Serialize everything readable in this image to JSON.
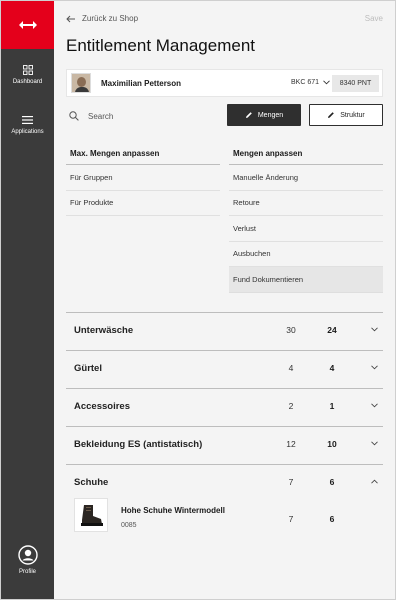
{
  "sidebar": {
    "items": [
      {
        "label": "Dashboard",
        "icon": "grid-icon"
      },
      {
        "label": "Applications",
        "icon": "menu-icon"
      }
    ],
    "profile_label": "Profile",
    "brand_color": "#e4001b"
  },
  "header": {
    "back_label": "Zurück zu Shop",
    "save_label": "Save",
    "title": "Entitlement Management"
  },
  "user": {
    "name": "Maximilian Petterson",
    "account": "BKC 671",
    "points": "8340 PNT"
  },
  "toolbar": {
    "search_placeholder": "Search",
    "mengen_label": "Mengen",
    "struktur_label": "Struktur"
  },
  "left_column": {
    "header": "Max. Mengen anpassen",
    "items": [
      "Für Gruppen",
      "Für Produkte"
    ]
  },
  "right_column": {
    "header": "Mengen anpassen",
    "items": [
      "Manuelle Änderung",
      "Retoure",
      "Verlust",
      "Ausbuchen",
      "Fund Dokumentieren"
    ],
    "active_index": 4
  },
  "categories": [
    {
      "name": "Unterwäsche",
      "v1": "30",
      "v2": "24"
    },
    {
      "name": "Gürtel",
      "v1": "4",
      "v2": "4"
    },
    {
      "name": "Accessoires",
      "v1": "2",
      "v2": "1"
    },
    {
      "name": "Bekleidung ES (antistatisch)",
      "v1": "12",
      "v2": "10"
    }
  ],
  "expanded_category": {
    "name": "Schuhe",
    "v1": "7",
    "v2": "6",
    "product": {
      "name": "Hohe Schuhe Wintermodell",
      "code": "0085",
      "v1": "7",
      "v2": "6"
    }
  }
}
